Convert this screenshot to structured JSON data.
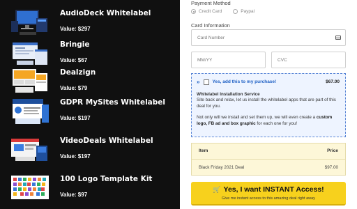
{
  "products": [
    {
      "name": "AudioDeck Whitelabel",
      "value": "Value: $297"
    },
    {
      "name": "Bringie",
      "value": "Value: $67"
    },
    {
      "name": "Dealzign",
      "value": "Value: $79"
    },
    {
      "name": "GDPR MySites Whitelabel",
      "value": "Value: $197"
    },
    {
      "name": "VideoDeals Whitelabel",
      "value": "Value: $197"
    },
    {
      "name": "100 Logo Template Kit",
      "value": "Value: $97"
    }
  ],
  "payment": {
    "title": "Payment Method",
    "options": [
      "Credit Card",
      "Paypal"
    ],
    "selected": "Credit Card"
  },
  "card": {
    "title": "Card Information",
    "number_placeholder": "Card Number",
    "expiry_placeholder": "MM/YY",
    "cvc_placeholder": "CVC"
  },
  "offer": {
    "arrows": "»",
    "checkbox_label": "Yes, add this to my purchase!",
    "price": "$67.00",
    "service_title": "Whitelabel Installation Service",
    "text1": "Site back and relax, let us install the whitelabel apps that are part of this deal for you.",
    "text2_pre": "Not only will we install and set them up, we will even create a ",
    "text2_bold": "custom logo, FB ad and box graphic",
    "text2_post": " for each one for you!"
  },
  "summary": {
    "col_item": "Item",
    "col_price": "Price",
    "row_item": "Black Friday 2021 Deal",
    "row_price": "$97.00"
  },
  "cta": {
    "main": "Yes, I want INSTANT Access!",
    "sub": "Give me instant access to this amazing deal right away"
  },
  "colors": {
    "left_bg": "#101010",
    "offer_bg": "#eef4ff",
    "offer_border": "#5a86d6",
    "table_bg": "#fdf7d8",
    "cta_bg": "#f7d11d"
  }
}
